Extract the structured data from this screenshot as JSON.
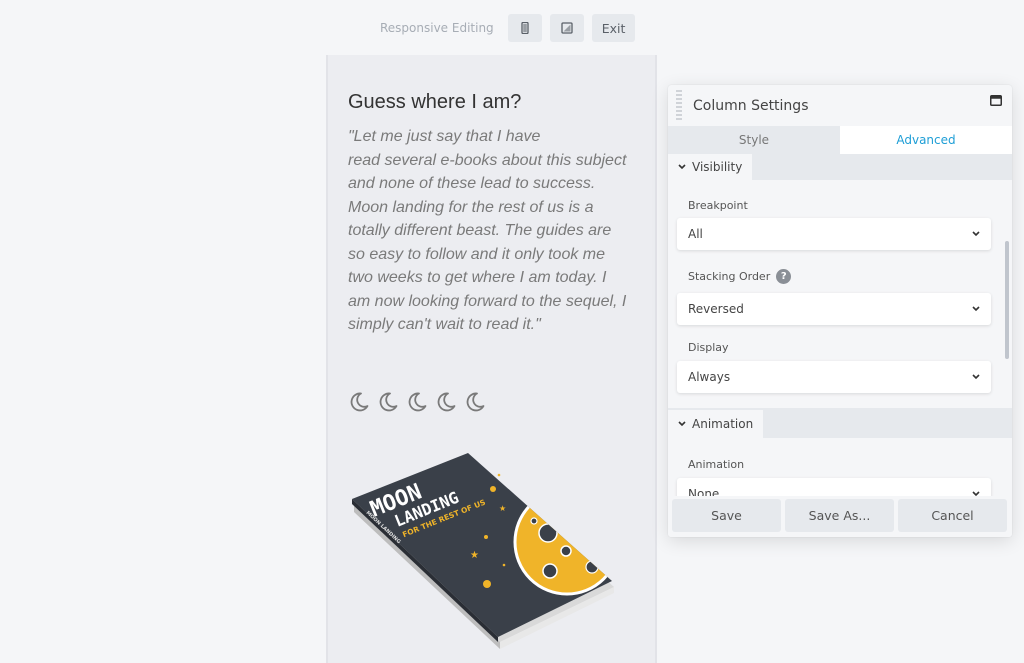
{
  "toolbar": {
    "label": "Responsive Editing",
    "buttons": [
      {
        "icon": "mobile-icon"
      },
      {
        "icon": "tablet-icon"
      }
    ],
    "exit_label": "Exit"
  },
  "preview": {
    "heading": "Guess where I am?",
    "quote_lines": [
      "\"Let me just say that I have",
      "read several e-books about this subject",
      "and none of these lead to success.",
      "Moon landing for the rest of us is a",
      "totally different beast. The guides are",
      "so easy to follow and it only took me",
      "two weeks to get where I am today. I",
      "am now looking forward to the sequel, I",
      "simply can't wait to read it.\""
    ],
    "rating": {
      "value": 5,
      "max": 5,
      "icon": "moon-icon"
    },
    "book": {
      "title_line1": "MOON",
      "title_line2": "LANDING",
      "subtitle": "FOR THE REST OF US",
      "spine": "MOON LANDING",
      "colors": {
        "cover": "#3a4049",
        "accent": "#f0b429"
      }
    }
  },
  "panel": {
    "title": "Column Settings",
    "tabs": [
      {
        "label": "Style",
        "active": false
      },
      {
        "label": "Advanced",
        "active": true
      }
    ],
    "sections": [
      {
        "title": "Visibility",
        "fields": [
          {
            "label": "Breakpoint",
            "value": "All",
            "help": false
          },
          {
            "label": "Stacking Order",
            "value": "Reversed",
            "help": true
          },
          {
            "label": "Display",
            "value": "Always",
            "help": false
          }
        ]
      },
      {
        "title": "Animation",
        "fields": [
          {
            "label": "Animation",
            "value": "None",
            "help": false
          }
        ]
      }
    ],
    "footer": {
      "save": "Save",
      "save_as": "Save As...",
      "cancel": "Cancel"
    },
    "accent_color": "#1e9ed6"
  }
}
